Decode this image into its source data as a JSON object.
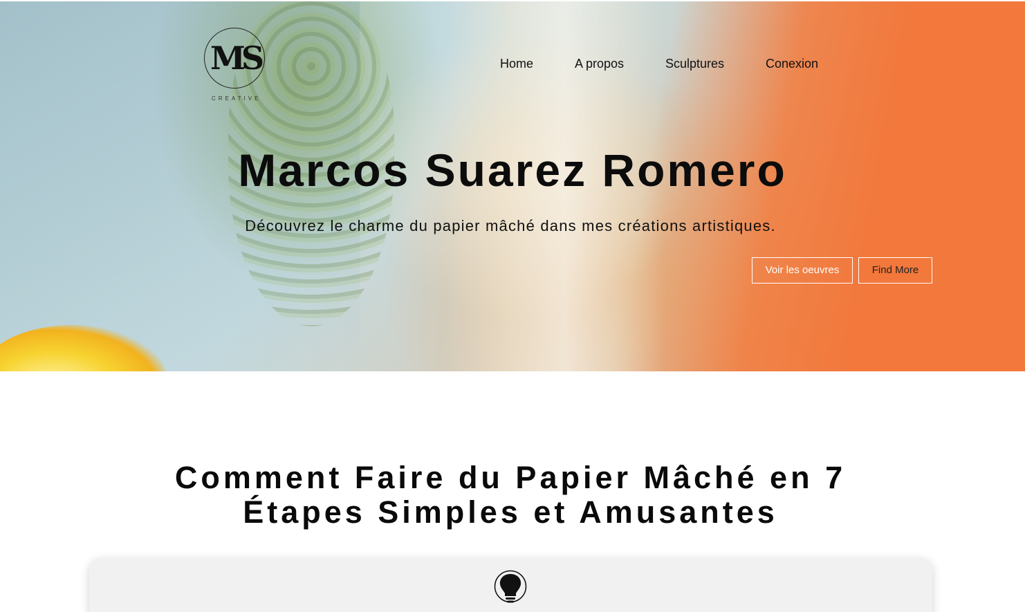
{
  "brand": {
    "logo_mark": "MS",
    "logo_tagline": "CREATIVE"
  },
  "nav": {
    "items": [
      {
        "label": "Home"
      },
      {
        "label": "A propos"
      },
      {
        "label": "Sculptures"
      },
      {
        "label": "Conexion"
      }
    ]
  },
  "hero": {
    "title": "Marcos Suarez Romero",
    "subtitle": "Découvrez le charme du papier mâché dans mes créations artistiques.",
    "primary_button": "Voir les oeuvres",
    "secondary_button": "Find More",
    "accent_color": "#f2783c"
  },
  "section": {
    "title_line1": "Comment Faire du Papier Mâché en 7",
    "title_line2": "Étapes Simples et Amusantes",
    "card_icon": "lightbulb-icon"
  }
}
